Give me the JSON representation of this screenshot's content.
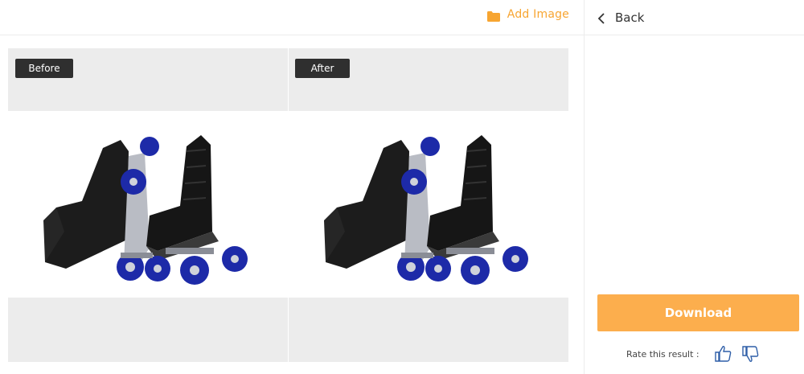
{
  "toolbar": {
    "add_image_label": "Add Image",
    "add_image_icon": "folder-icon",
    "accent_color": "#f7a531"
  },
  "sidebar": {
    "back_label": "Back",
    "back_icon": "chevron-left-icon",
    "download_label": "Download",
    "download_color": "#fcae4d",
    "rate_label": "Rate this result :",
    "rate_icons": [
      "thumbs-up-icon",
      "thumbs-down-icon"
    ]
  },
  "compare": {
    "before_label": "Before",
    "after_label": "After",
    "image_subject": "roller-skates"
  }
}
